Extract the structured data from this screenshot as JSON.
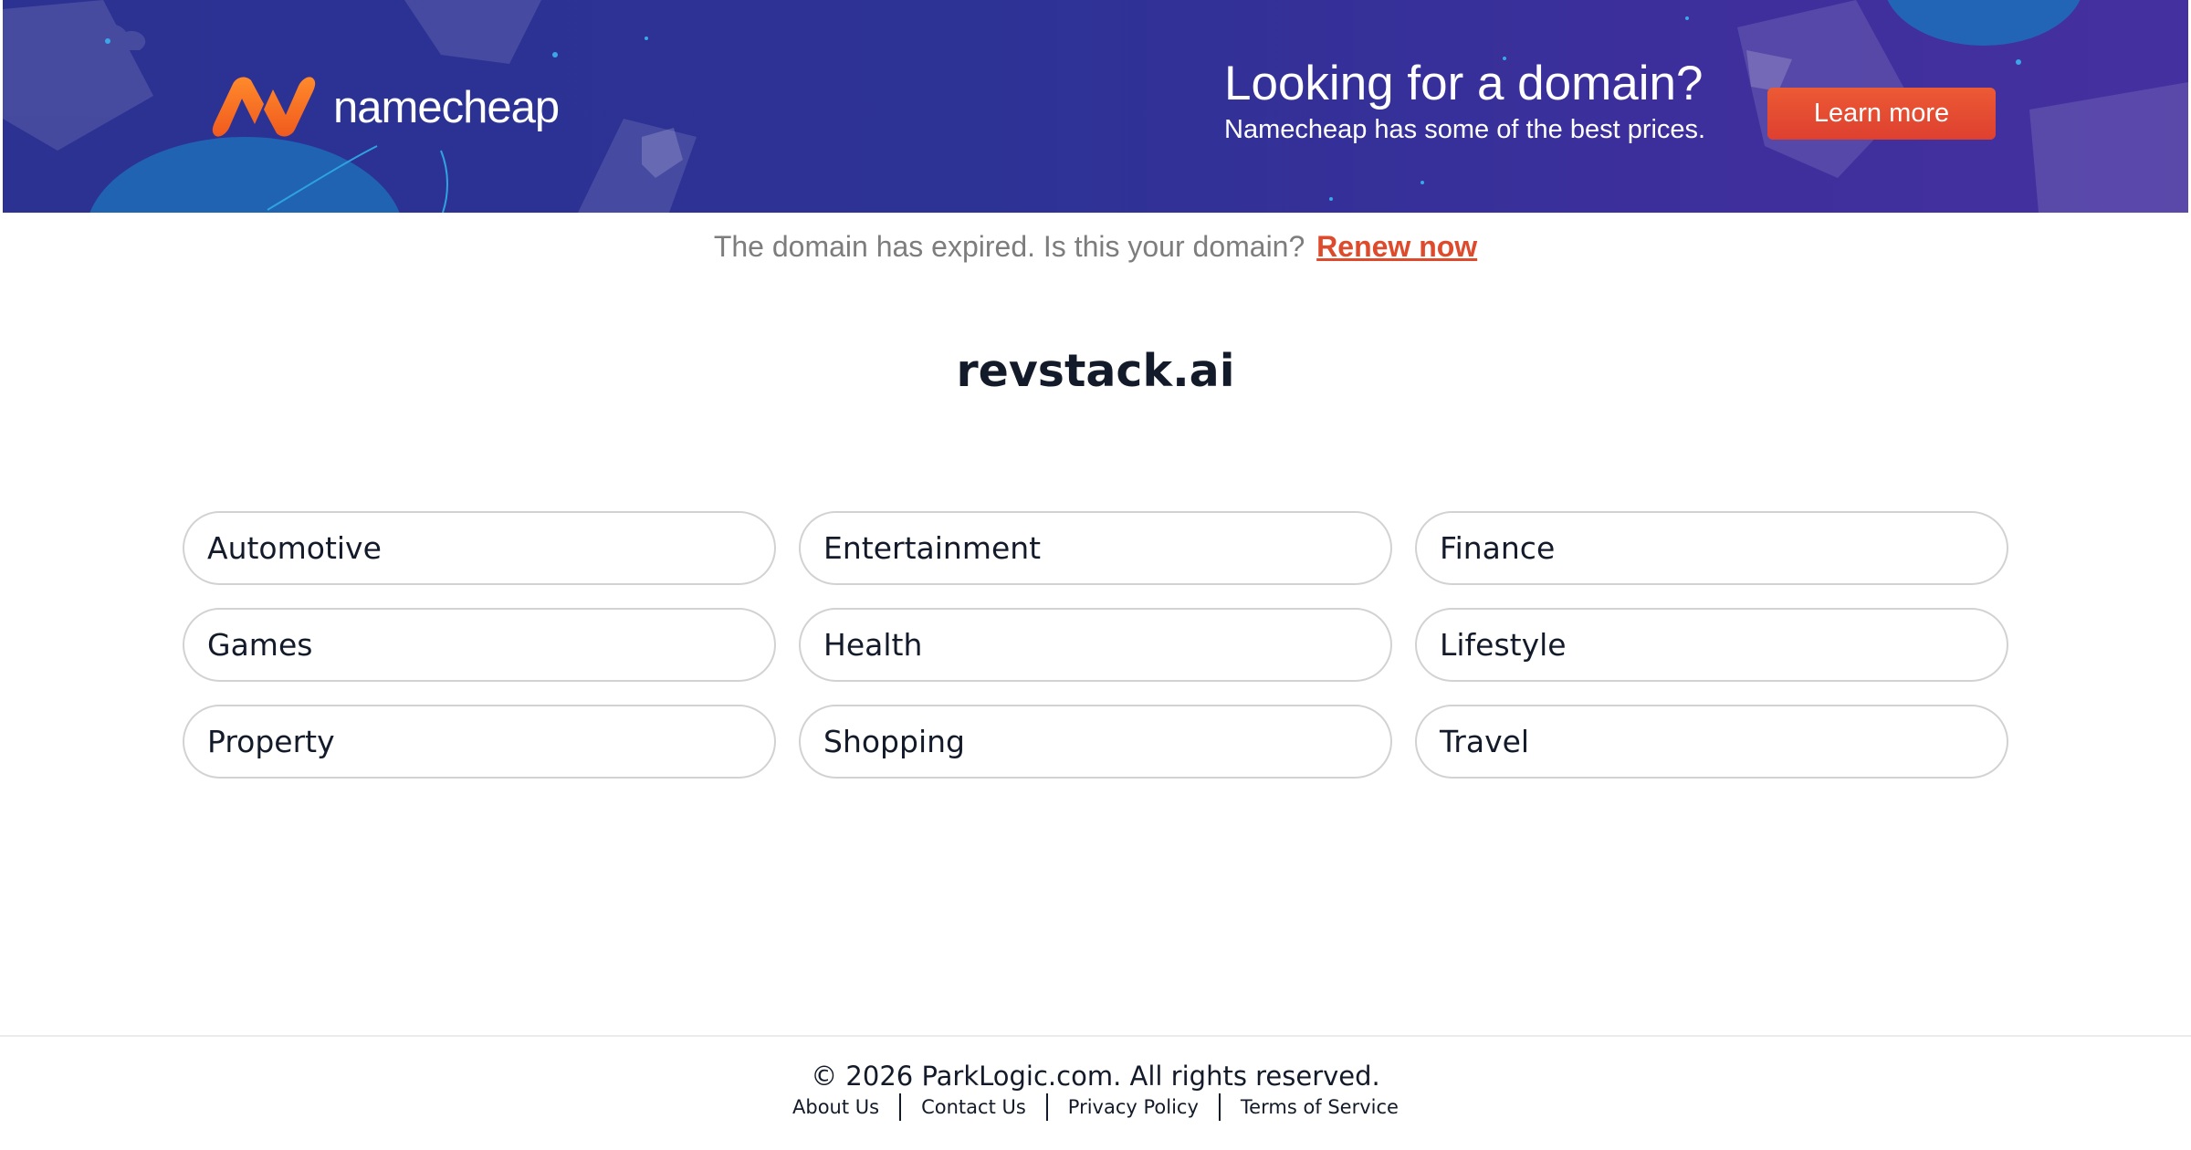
{
  "banner": {
    "brand_name": "namecheap",
    "promo_title": "Looking for a domain?",
    "promo_subtitle": "Namecheap has some of the best prices.",
    "cta_label": "Learn more",
    "colors": {
      "background": "#2d3295",
      "accent": "#e8522f",
      "logo_orange": "#f26b1d"
    }
  },
  "notice": {
    "text": "The domain has expired. Is this your domain?",
    "link_label": "Renew now"
  },
  "domain": {
    "name": "revstack.ai"
  },
  "categories": [
    "Automotive",
    "Entertainment",
    "Finance",
    "Games",
    "Health",
    "Lifestyle",
    "Property",
    "Shopping",
    "Travel"
  ],
  "footer": {
    "copyright": "© 2026 ParkLogic.com. All rights reserved.",
    "links": [
      "About Us",
      "Contact Us",
      "Privacy Policy",
      "Terms of Service"
    ]
  }
}
